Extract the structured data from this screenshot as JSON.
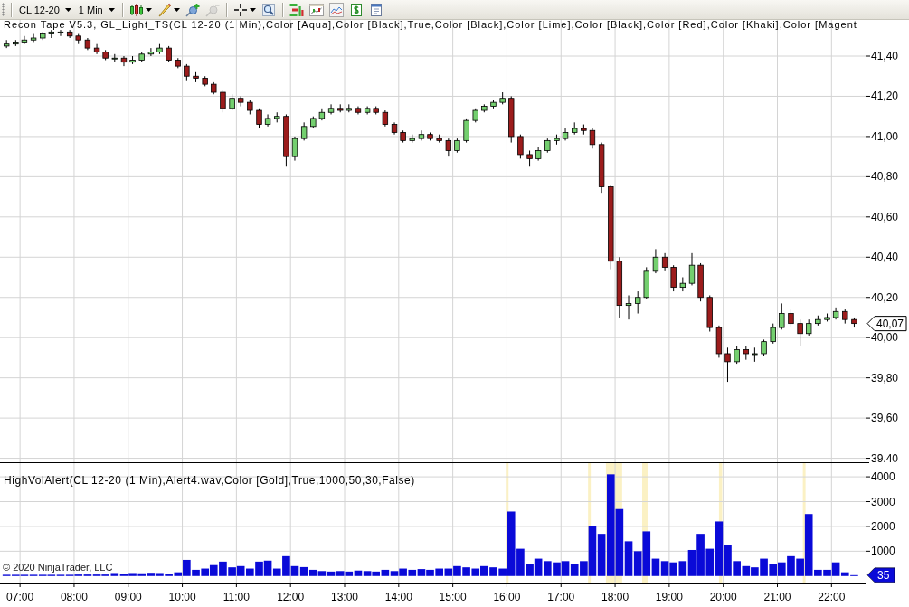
{
  "toolbar": {
    "instrument_menu": "CL 12-20",
    "interval_menu": "1 Min",
    "tool_groups": [
      [
        {
          "kind": "candles",
          "dropdown": true,
          "disabled": false
        },
        {
          "kind": "pencil",
          "dropdown": true,
          "disabled": false
        },
        {
          "kind": "pin",
          "dropdown": false,
          "disabled": false
        },
        {
          "kind": "unpin",
          "dropdown": false,
          "disabled": true
        }
      ],
      [
        {
          "kind": "crosshair",
          "dropdown": true,
          "disabled": false
        },
        {
          "kind": "zoom",
          "dropdown": false,
          "disabled": false
        }
      ],
      [
        {
          "kind": "strategy",
          "dropdown": false,
          "disabled": false
        },
        {
          "kind": "bars",
          "dropdown": false,
          "disabled": false
        },
        {
          "kind": "linechart",
          "dropdown": false,
          "disabled": false
        },
        {
          "kind": "dollar",
          "dropdown": false,
          "disabled": false
        },
        {
          "kind": "properties",
          "dropdown": false,
          "disabled": false
        }
      ]
    ]
  },
  "price_panel": {
    "indicator_label": "Recon Tape V5.3, GL_Light_TS(CL 12-20 (1 Min),Color [Aqua],Color [Black],True,Color [Black],Color [Lime],Color [Black],Color [Red],Color [Khaki],Color [Magent",
    "price_marker": "40,07",
    "chart_data": [
      {
        "type": "candlestick",
        "x": [
          6.75,
          6.92,
          7.08,
          7.25,
          7.42,
          7.58,
          7.75,
          7.92,
          8.08,
          8.25,
          8.42,
          8.58,
          8.75,
          8.92,
          9.08,
          9.25,
          9.42,
          9.58,
          9.75,
          9.92,
          10.08,
          10.25,
          10.42,
          10.58,
          10.75,
          10.92,
          11.08,
          11.25,
          11.42,
          11.58,
          11.75,
          11.92,
          12.08,
          12.25,
          12.42,
          12.58,
          12.75,
          12.92,
          13.08,
          13.25,
          13.42,
          13.58,
          13.75,
          13.92,
          14.08,
          14.25,
          14.42,
          14.58,
          14.75,
          14.92,
          15.08,
          15.25,
          15.42,
          15.58,
          15.75,
          15.92,
          16.08,
          16.25,
          16.42,
          16.58,
          16.75,
          16.92,
          17.08,
          17.25,
          17.42,
          17.58,
          17.75,
          17.92,
          18.08,
          18.25,
          18.42,
          18.58,
          18.75,
          18.92,
          19.08,
          19.25,
          19.42,
          19.58,
          19.75,
          19.92,
          20.08,
          20.25,
          20.42,
          20.58,
          20.75,
          20.92,
          21.08,
          21.25,
          21.42,
          21.58,
          21.75,
          21.92,
          22.08,
          22.25,
          22.42
        ],
        "ohlc": [
          [
            41.45,
            41.48,
            41.44,
            41.46
          ],
          [
            41.46,
            41.48,
            41.45,
            41.47
          ],
          [
            41.47,
            41.5,
            41.46,
            41.48
          ],
          [
            41.48,
            41.51,
            41.47,
            41.49
          ],
          [
            41.49,
            41.52,
            41.48,
            41.51
          ],
          [
            41.51,
            41.53,
            41.49,
            41.52
          ],
          [
            41.52,
            41.53,
            41.5,
            41.52
          ],
          [
            41.52,
            41.53,
            41.49,
            41.5
          ],
          [
            41.5,
            41.51,
            41.46,
            41.48
          ],
          [
            41.48,
            41.49,
            41.43,
            41.44
          ],
          [
            41.44,
            41.46,
            41.41,
            41.42
          ],
          [
            41.42,
            41.43,
            41.38,
            41.39
          ],
          [
            41.39,
            41.41,
            41.37,
            41.39
          ],
          [
            41.39,
            41.4,
            41.35,
            41.37
          ],
          [
            41.37,
            41.4,
            41.36,
            41.38
          ],
          [
            41.38,
            41.42,
            41.37,
            41.41
          ],
          [
            41.41,
            41.44,
            41.4,
            41.42
          ],
          [
            41.42,
            41.46,
            41.41,
            41.44
          ],
          [
            41.44,
            41.45,
            41.37,
            41.38
          ],
          [
            41.38,
            41.39,
            41.34,
            41.35
          ],
          [
            41.35,
            41.36,
            41.28,
            41.3
          ],
          [
            41.3,
            41.32,
            41.27,
            41.29
          ],
          [
            41.29,
            41.3,
            41.25,
            41.26
          ],
          [
            41.26,
            41.27,
            41.21,
            41.22
          ],
          [
            41.22,
            41.23,
            41.12,
            41.14
          ],
          [
            41.14,
            41.21,
            41.13,
            41.19
          ],
          [
            41.19,
            41.2,
            41.15,
            41.17
          ],
          [
            41.17,
            41.18,
            41.11,
            41.13
          ],
          [
            41.13,
            41.14,
            41.04,
            41.06
          ],
          [
            41.06,
            41.11,
            41.05,
            41.09
          ],
          [
            41.09,
            41.12,
            41.07,
            41.1
          ],
          [
            41.1,
            41.11,
            40.85,
            40.9
          ],
          [
            40.9,
            41.0,
            40.88,
            40.99
          ],
          [
            40.99,
            41.07,
            40.98,
            41.05
          ],
          [
            41.05,
            41.1,
            41.04,
            41.09
          ],
          [
            41.09,
            41.14,
            41.08,
            41.12
          ],
          [
            41.12,
            41.16,
            41.11,
            41.14
          ],
          [
            41.14,
            41.16,
            41.12,
            41.13
          ],
          [
            41.13,
            41.16,
            41.12,
            41.14
          ],
          [
            41.14,
            41.15,
            41.11,
            41.12
          ],
          [
            41.12,
            41.15,
            41.11,
            41.14
          ],
          [
            41.14,
            41.15,
            41.11,
            41.12
          ],
          [
            41.12,
            41.13,
            41.05,
            41.06
          ],
          [
            41.06,
            41.07,
            41.01,
            41.02
          ],
          [
            41.02,
            41.03,
            40.97,
            40.98
          ],
          [
            40.98,
            41.01,
            40.97,
            40.99
          ],
          [
            40.99,
            41.03,
            40.98,
            41.01
          ],
          [
            41.01,
            41.02,
            40.98,
            40.99
          ],
          [
            40.99,
            41.01,
            40.97,
            40.98
          ],
          [
            40.98,
            40.99,
            40.9,
            40.93
          ],
          [
            40.93,
            40.99,
            40.92,
            40.98
          ],
          [
            40.98,
            41.09,
            40.97,
            41.08
          ],
          [
            41.08,
            41.14,
            41.07,
            41.13
          ],
          [
            41.13,
            41.16,
            41.12,
            41.15
          ],
          [
            41.15,
            41.18,
            41.14,
            41.17
          ],
          [
            41.17,
            41.22,
            41.16,
            41.19
          ],
          [
            41.19,
            41.2,
            40.97,
            41.0
          ],
          [
            41.0,
            41.01,
            40.89,
            40.91
          ],
          [
            40.91,
            40.93,
            40.85,
            40.89
          ],
          [
            40.89,
            40.95,
            40.88,
            40.93
          ],
          [
            40.93,
            40.99,
            40.92,
            40.98
          ],
          [
            40.98,
            41.01,
            40.96,
            40.99
          ],
          [
            40.99,
            41.04,
            40.98,
            41.02
          ],
          [
            41.02,
            41.07,
            41.01,
            41.04
          ],
          [
            41.04,
            41.06,
            41.01,
            41.03
          ],
          [
            41.03,
            41.04,
            40.94,
            40.96
          ],
          [
            40.96,
            40.97,
            40.72,
            40.75
          ],
          [
            40.75,
            40.76,
            40.34,
            40.38
          ],
          [
            40.38,
            40.4,
            40.1,
            40.16
          ],
          [
            40.16,
            40.21,
            40.09,
            40.17
          ],
          [
            40.17,
            40.23,
            40.12,
            40.2
          ],
          [
            40.2,
            40.35,
            40.19,
            40.33
          ],
          [
            40.33,
            40.44,
            40.32,
            40.4
          ],
          [
            40.4,
            40.42,
            40.33,
            40.35
          ],
          [
            40.35,
            40.36,
            40.23,
            40.25
          ],
          [
            40.25,
            40.3,
            40.23,
            40.27
          ],
          [
            40.27,
            40.42,
            40.26,
            40.36
          ],
          [
            40.36,
            40.37,
            40.18,
            40.2
          ],
          [
            40.2,
            40.21,
            40.03,
            40.05
          ],
          [
            40.05,
            40.06,
            39.9,
            39.92
          ],
          [
            39.92,
            39.95,
            39.78,
            39.88
          ],
          [
            39.88,
            39.96,
            39.87,
            39.94
          ],
          [
            39.94,
            39.96,
            39.89,
            39.92
          ],
          [
            39.92,
            39.95,
            39.88,
            39.92
          ],
          [
            39.92,
            39.99,
            39.91,
            39.98
          ],
          [
            39.98,
            40.07,
            39.97,
            40.05
          ],
          [
            40.05,
            40.17,
            40.04,
            40.12
          ],
          [
            40.12,
            40.14,
            40.05,
            40.07
          ],
          [
            40.07,
            40.09,
            39.96,
            40.02
          ],
          [
            40.02,
            40.09,
            40.01,
            40.07
          ],
          [
            40.07,
            40.11,
            40.06,
            40.09
          ],
          [
            40.09,
            40.12,
            40.08,
            40.1
          ],
          [
            40.1,
            40.15,
            40.09,
            40.13
          ],
          [
            40.13,
            40.14,
            40.07,
            40.09
          ],
          [
            40.09,
            40.1,
            40.05,
            40.07
          ]
        ],
        "xlim": [
          6.63,
          22.63
        ],
        "ylim": [
          39.38,
          41.58
        ],
        "xticks": [
          7,
          8,
          9,
          10,
          11,
          12,
          13,
          14,
          15,
          16,
          17,
          18,
          19,
          20,
          21,
          22
        ],
        "yticks": [
          {
            "value": 39.4,
            "label": "39,40"
          },
          {
            "value": 39.6,
            "label": "39,60"
          },
          {
            "value": 39.8,
            "label": "39,80"
          },
          {
            "value": 40.0,
            "label": "40,00"
          },
          {
            "value": 40.2,
            "label": "40,20"
          },
          {
            "value": 40.4,
            "label": "40,40"
          },
          {
            "value": 40.6,
            "label": "40,60"
          },
          {
            "value": 40.8,
            "label": "40,80"
          },
          {
            "value": 41.0,
            "label": "41,00"
          },
          {
            "value": 41.2,
            "label": "41,20"
          },
          {
            "value": 41.4,
            "label": "41,40"
          }
        ],
        "tick_labels": "y",
        "grid": true
      }
    ]
  },
  "volume_panel": {
    "indicator_label": "HighVolAlert(CL 12-20 (1 Min),Alert4.wav,Color [Gold],True,1000,50,30,False)",
    "value_marker": "35",
    "copyright": "© 2020 NinjaTrader, LLC",
    "chart_data": [
      {
        "type": "bar",
        "x": [
          6.75,
          6.92,
          7.08,
          7.25,
          7.42,
          7.58,
          7.75,
          7.92,
          8.08,
          8.25,
          8.42,
          8.58,
          8.75,
          8.92,
          9.08,
          9.25,
          9.42,
          9.58,
          9.75,
          9.92,
          10.08,
          10.25,
          10.42,
          10.58,
          10.75,
          10.92,
          11.08,
          11.25,
          11.42,
          11.58,
          11.75,
          11.92,
          12.08,
          12.25,
          12.42,
          12.58,
          12.75,
          12.92,
          13.08,
          13.25,
          13.42,
          13.58,
          13.75,
          13.92,
          14.08,
          14.25,
          14.42,
          14.58,
          14.75,
          14.92,
          15.08,
          15.25,
          15.42,
          15.58,
          15.75,
          15.92,
          16.08,
          16.25,
          16.42,
          16.58,
          16.75,
          16.92,
          17.08,
          17.25,
          17.42,
          17.58,
          17.75,
          17.92,
          18.08,
          18.25,
          18.42,
          18.58,
          18.75,
          18.92,
          19.08,
          19.25,
          19.42,
          19.58,
          19.75,
          19.92,
          20.08,
          20.25,
          20.42,
          20.58,
          20.75,
          20.92,
          21.08,
          21.25,
          21.42,
          21.58,
          21.75,
          21.92,
          22.08,
          22.25,
          22.42
        ],
        "values": [
          50,
          50,
          50,
          50,
          50,
          50,
          50,
          50,
          60,
          60,
          60,
          60,
          120,
          80,
          120,
          110,
          130,
          120,
          100,
          150,
          650,
          250,
          300,
          440,
          580,
          350,
          400,
          300,
          580,
          620,
          300,
          800,
          400,
          360,
          250,
          200,
          180,
          200,
          180,
          220,
          200,
          180,
          250,
          200,
          300,
          250,
          280,
          250,
          300,
          300,
          400,
          350,
          300,
          400,
          350,
          300,
          2600,
          1100,
          500,
          700,
          600,
          550,
          600,
          500,
          600,
          2000,
          1700,
          4100,
          2700,
          1400,
          1000,
          1800,
          700,
          600,
          550,
          600,
          1050,
          1700,
          1100,
          2200,
          1250,
          600,
          400,
          350,
          700,
          500,
          550,
          800,
          700,
          2500,
          250,
          250,
          550,
          150,
          35
        ],
        "color": "#0a0ad8",
        "xlim": [
          6.63,
          22.63
        ],
        "ylim": [
          -300,
          4550
        ],
        "xticks": [
          {
            "value": 7,
            "label": "07:00"
          },
          {
            "value": 8,
            "label": "08:00"
          },
          {
            "value": 9,
            "label": "09:00"
          },
          {
            "value": 10,
            "label": "10:00"
          },
          {
            "value": 11,
            "label": "11:00"
          },
          {
            "value": 12,
            "label": "12:00"
          },
          {
            "value": 13,
            "label": "13:00"
          },
          {
            "value": 14,
            "label": "14:00"
          },
          {
            "value": 15,
            "label": "15:00"
          },
          {
            "value": 16,
            "label": "16:00"
          },
          {
            "value": 17,
            "label": "17:00"
          },
          {
            "value": 18,
            "label": "18:00"
          },
          {
            "value": 19,
            "label": "19:00"
          },
          {
            "value": 20,
            "label": "20:00"
          },
          {
            "value": 21,
            "label": "21:00"
          },
          {
            "value": 22,
            "label": "22:00"
          }
        ],
        "yticks": [
          1000,
          2000,
          3000,
          4000
        ],
        "grid": true,
        "bands": [
          {
            "axis": "x",
            "from": 15.98,
            "to": 16.03,
            "color": "#fbf1c4"
          },
          {
            "axis": "x",
            "from": 17.5,
            "to": 17.55,
            "color": "#fbf1c4"
          },
          {
            "axis": "x",
            "from": 17.83,
            "to": 18.13,
            "color": "#fbf1c4"
          },
          {
            "axis": "x",
            "from": 18.5,
            "to": 18.6,
            "color": "#fbf1c4"
          },
          {
            "axis": "x",
            "from": 19.92,
            "to": 19.98,
            "color": "#fbf1c4"
          },
          {
            "axis": "x",
            "from": 21.47,
            "to": 21.52,
            "color": "#fbf1c4"
          }
        ]
      }
    ]
  }
}
